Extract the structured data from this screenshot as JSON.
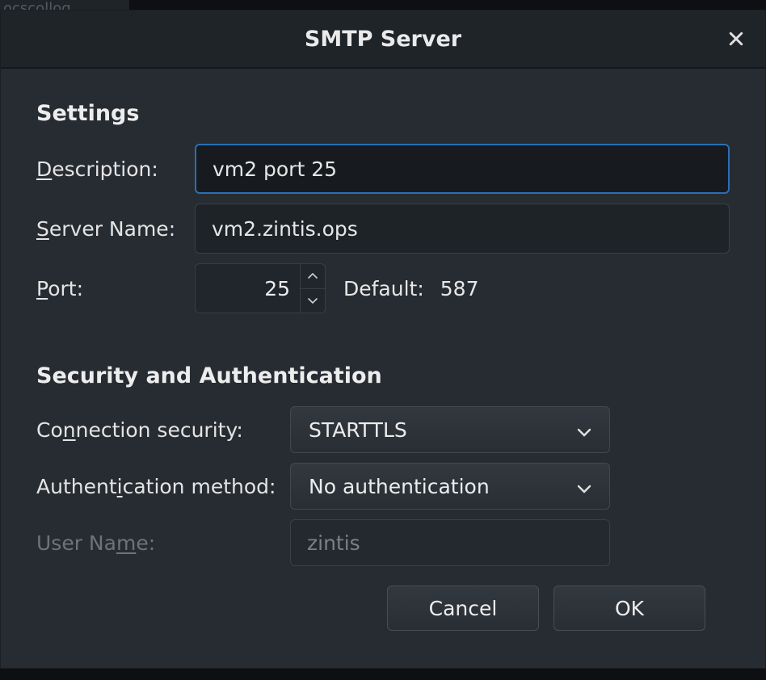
{
  "background_tab": "ocscollog",
  "dialog": {
    "title": "SMTP Server",
    "sections": {
      "settings": {
        "heading": "Settings",
        "description_pre": "D",
        "description_u": "escription:",
        "description_value": "vm2 port 25",
        "server_pre": "S",
        "server_u": "erver Name:",
        "server_value": "vm2.zintis.ops",
        "port_pre": "P",
        "port_u": "ort:",
        "port_value": "25",
        "default_label": "Default:",
        "default_value": "587"
      },
      "security": {
        "heading": "Security and Authentication",
        "conn_pre": "Co",
        "conn_u": "n",
        "conn_post": "nection security:",
        "conn_value": "STARTTLS",
        "auth_pre": "Authent",
        "auth_u": "i",
        "auth_post": "cation method:",
        "auth_value": "No authentication",
        "user_pre": "User Na",
        "user_u": "m",
        "user_post": "e:",
        "user_value": "zintis"
      }
    },
    "buttons": {
      "cancel": "Cancel",
      "ok": "OK"
    }
  }
}
